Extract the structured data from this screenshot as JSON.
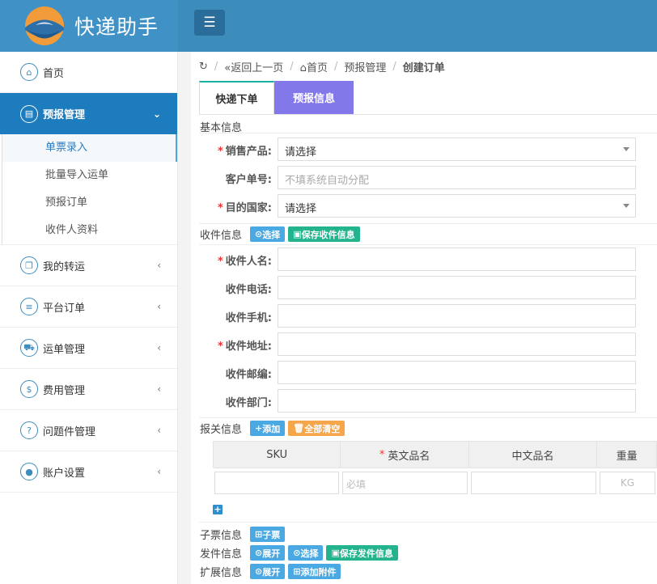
{
  "app": {
    "title": "快递助手"
  },
  "topbar": {
    "menu_icon": "bars-icon"
  },
  "sidebar": {
    "items": [
      {
        "label": "首页",
        "icon": "home-icon"
      },
      {
        "label": "预报管理",
        "icon": "file-icon",
        "active": true
      },
      {
        "label": "我的转运",
        "icon": "copy-icon"
      },
      {
        "label": "平台订单",
        "icon": "list-icon"
      },
      {
        "label": "运单管理",
        "icon": "truck-icon"
      },
      {
        "label": "费用管理",
        "icon": "dollar-icon"
      },
      {
        "label": "问题件管理",
        "icon": "question-icon"
      },
      {
        "label": "账户设置",
        "icon": "user-icon"
      }
    ],
    "sub_items": [
      "单票录入",
      "批量导入运单",
      "预报订单",
      "收件人资料"
    ]
  },
  "breadcrumb": {
    "back": "返回上一页",
    "home": "首页",
    "section": "预报管理",
    "current": "创建订单"
  },
  "tabs": [
    "快递下单",
    "预报信息"
  ],
  "basic": {
    "title": "基本信息",
    "product_label": "销售产品:",
    "product_value": "请选择",
    "customer_no_label": "客户单号:",
    "customer_no_placeholder": "不填系统自动分配",
    "country_label": "目的国家:",
    "country_value": "请选择"
  },
  "receiver": {
    "title": "收件信息",
    "select_btn": "选择",
    "save_btn": "保存收件信息",
    "name_label": "收件人名:",
    "phone_label": "收件电话:",
    "mobile_label": "收件手机:",
    "address_label": "收件地址:",
    "zip_label": "收件邮编:",
    "house_label": "收件部门:"
  },
  "declaration": {
    "title": "报关信息",
    "add_btn": "添加",
    "clear_btn": "全部清空",
    "columns": [
      "SKU",
      "英文品名",
      "中文品名",
      "重量"
    ],
    "row_placeholders": [
      "",
      "必填",
      "",
      "KG"
    ]
  },
  "subticket": {
    "title": "子票信息",
    "btn": "子票"
  },
  "sender": {
    "title": "发件信息",
    "expand_btn": "展开",
    "select_btn": "选择",
    "save_btn": "保存发件信息"
  },
  "extended": {
    "title": "扩展信息",
    "expand_btn": "展开",
    "attach_btn": "添加附件"
  },
  "colors": {
    "topbar": "#3c8dbc",
    "sidebar_active": "#1d7cbe",
    "tab_secondary": "#8378ea",
    "btn_blue": "#4aa8e2",
    "btn_green": "#23b38d",
    "btn_orange": "#f5a64b"
  }
}
